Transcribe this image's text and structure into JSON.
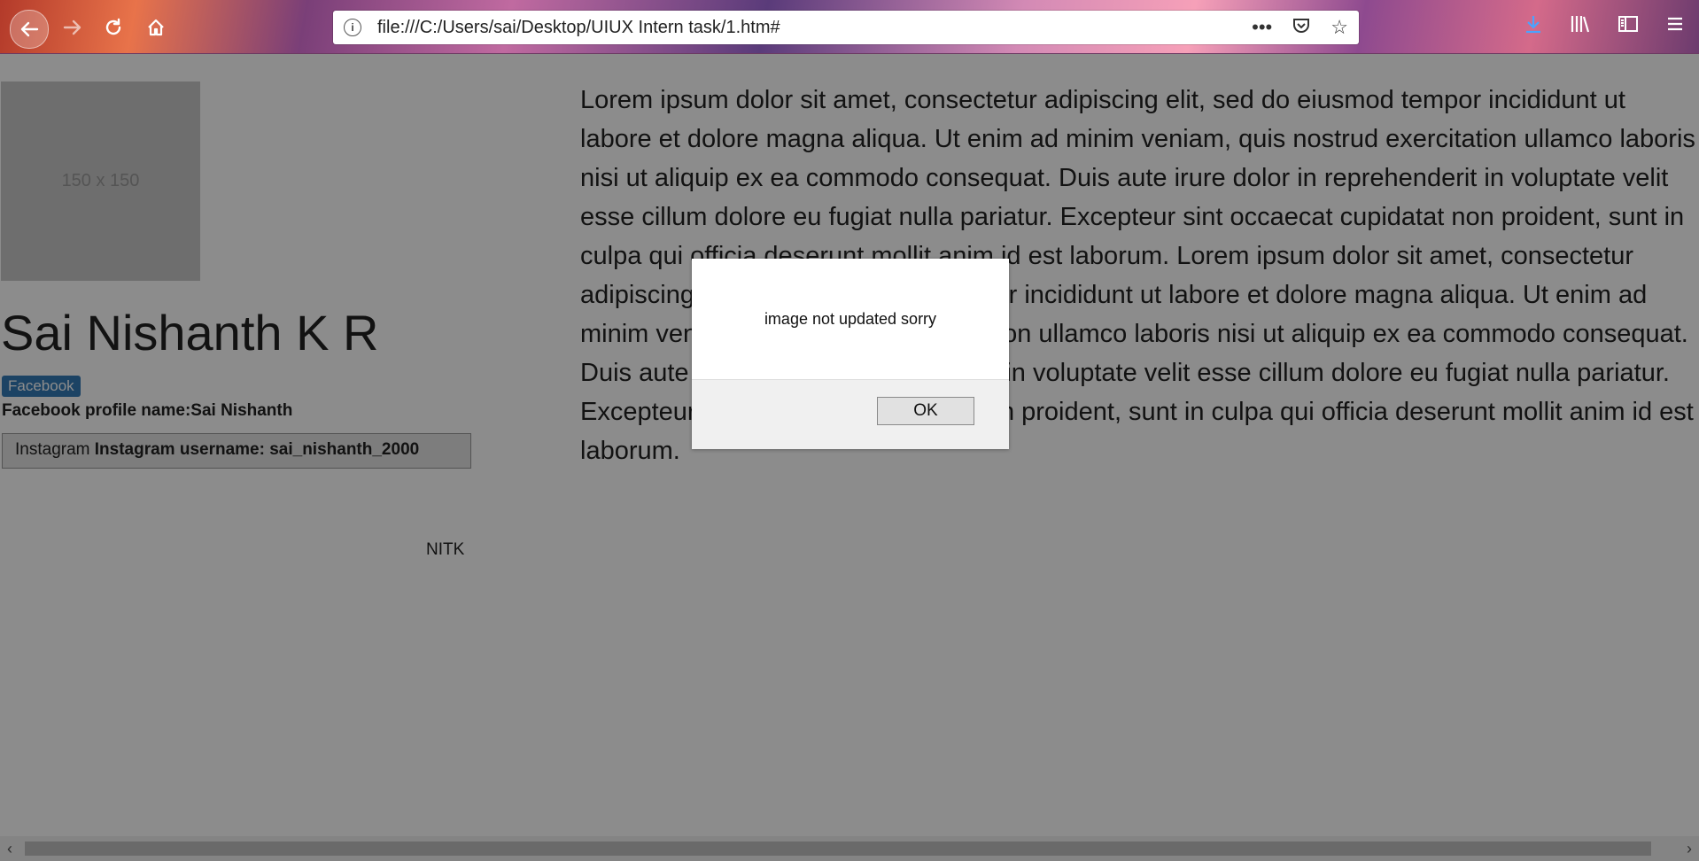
{
  "browser": {
    "url": "file:///C:/Users/sai/Desktop/UIUX Intern task/1.htm#",
    "icons": [
      "back-icon",
      "forward-icon",
      "reload-icon",
      "home-icon",
      "info-icon",
      "more-icon",
      "pocket-icon",
      "bookmark-star-icon",
      "download-icon",
      "library-icon",
      "sidebar-icon",
      "menu-icon"
    ]
  },
  "profile": {
    "avatar_placeholder": "150 x 150",
    "name": "Sai Nishanth K R",
    "facebook_badge": "Facebook",
    "facebook_profile": "Facebook profile name:Sai Nishanth",
    "instagram_label": "Instagram",
    "instagram_username": "Instagram username: sai_nishanth_2000",
    "institution": "NITK"
  },
  "content": {
    "lorem": "Lorem ipsum dolor sit amet, consectetur adipiscing elit, sed do eiusmod tempor incididunt ut labore et dolore magna aliqua. Ut enim ad minim veniam, quis nostrud exercitation ullamco laboris nisi ut aliquip ex ea commodo consequat. Duis aute irure dolor in reprehenderit in voluptate velit esse cillum dolore eu fugiat nulla pariatur. Excepteur sint occaecat cupidatat non proident, sunt in culpa qui officia deserunt mollit anim id est laborum. Lorem ipsum dolor sit amet, consectetur adipiscing elit, sed do eiusmod tempor incididunt ut labore et dolore magna aliqua. Ut enim ad minim veniam, quis nostrud exercitation ullamco laboris nisi ut aliquip ex ea commodo consequat. Duis aute irure dolor in reprehenderit in voluptate velit esse cillum dolore eu fugiat nulla pariatur. Excepteur sint occaecat cupidatat non proident, sunt in culpa qui officia deserunt mollit anim id est laborum."
  },
  "dialog": {
    "message": "image not updated sorry",
    "ok_label": "OK"
  }
}
